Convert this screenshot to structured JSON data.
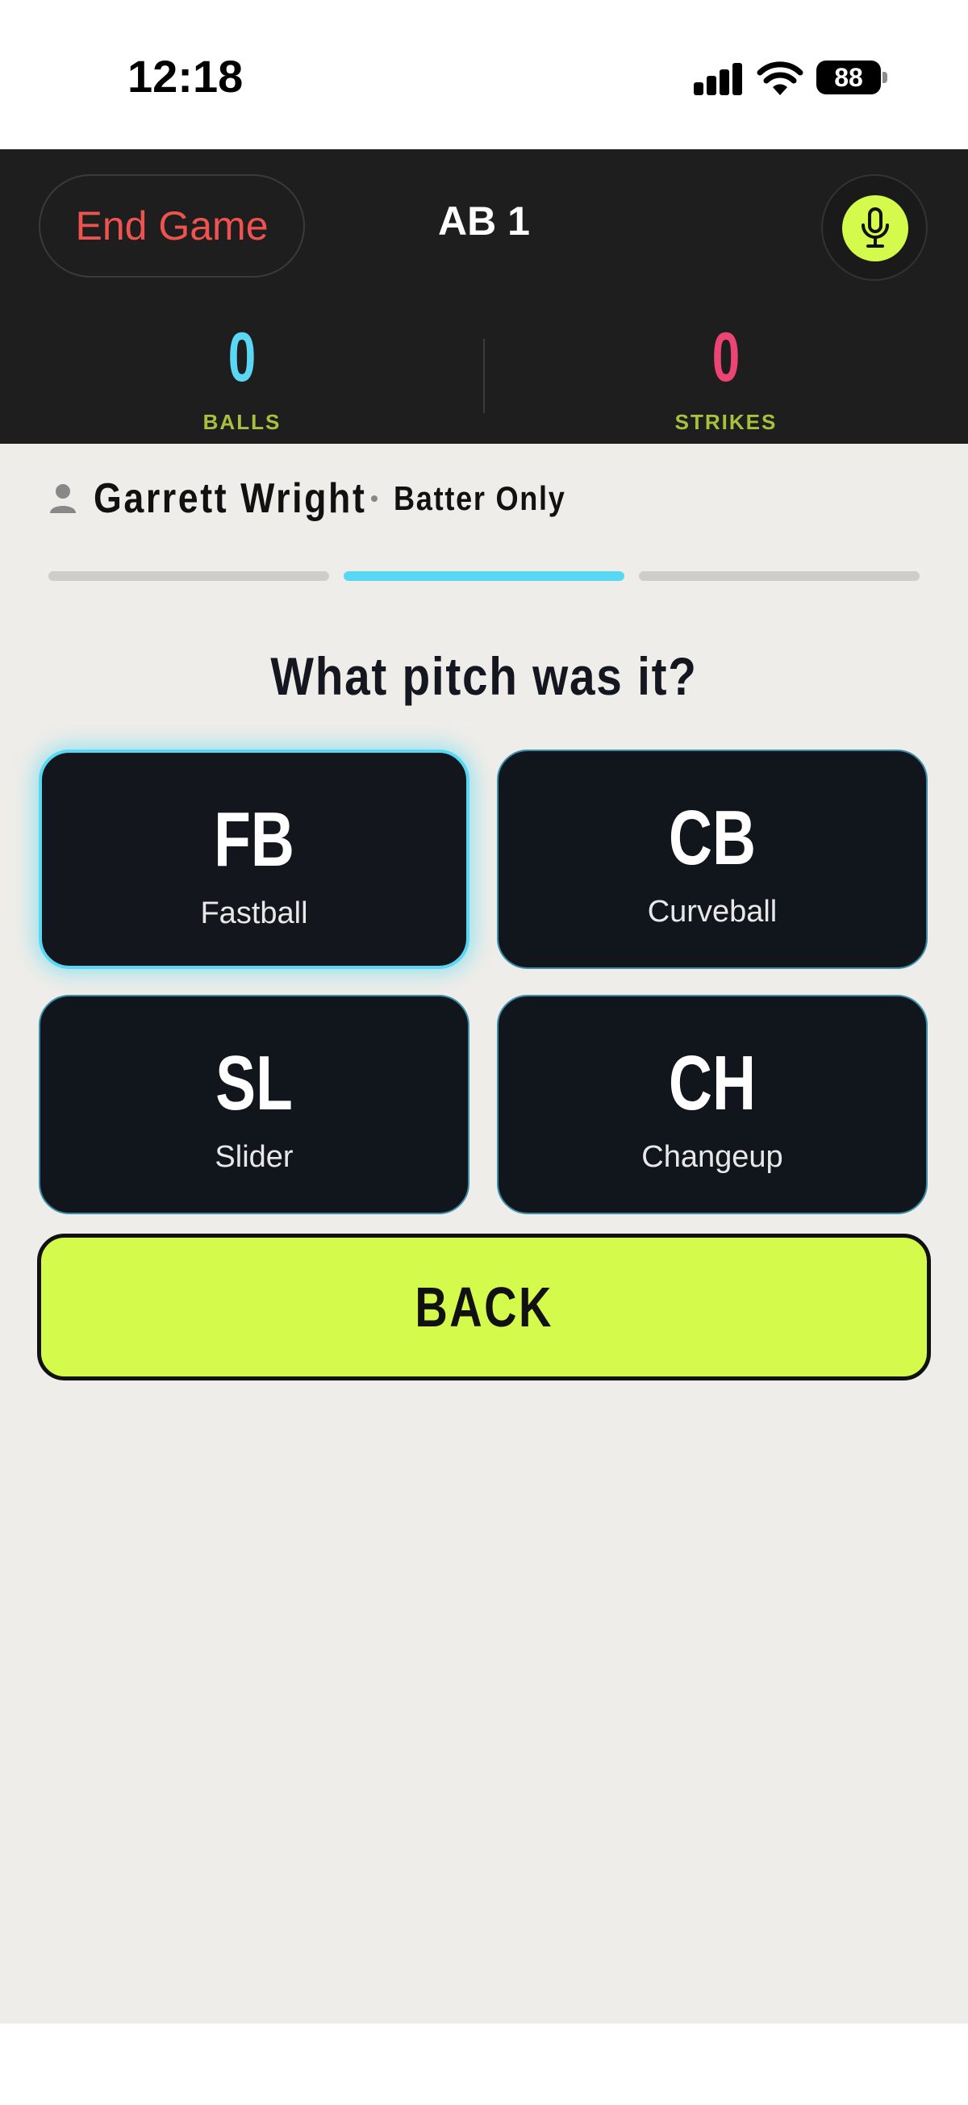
{
  "status_bar": {
    "time": "12:18",
    "battery": "88",
    "icons": [
      "signal-icon",
      "wifi-icon",
      "battery-icon"
    ]
  },
  "header": {
    "end_game_label": "End Game",
    "at_bat_label": "AB 1",
    "mic_icon": "microphone-icon",
    "balls": {
      "value": "0",
      "label": "BALLS",
      "color": "#5ad8f3"
    },
    "strikes": {
      "value": "0",
      "label": "STRIKES",
      "color": "#ec4474"
    }
  },
  "batter": {
    "icon": "person-icon",
    "name": "Garrett Wright",
    "role": "Batter Only"
  },
  "progress": {
    "steps": 3,
    "active_step": 2
  },
  "question": "What pitch was it?",
  "pitches": [
    {
      "code": "FB",
      "name": "Fastball",
      "selected": true
    },
    {
      "code": "CB",
      "name": "Curveball",
      "selected": false
    },
    {
      "code": "SL",
      "name": "Slider",
      "selected": false
    },
    {
      "code": "CH",
      "name": "Changeup",
      "selected": false
    }
  ],
  "back_label": "BACK",
  "colors": {
    "accent_lime": "#d4fb4b",
    "accent_cyan": "#5ad8f3",
    "accent_red": "#ef5350",
    "header_bg": "#1e1e1e",
    "main_bg": "#efede9",
    "card_bg": "#11151c"
  }
}
